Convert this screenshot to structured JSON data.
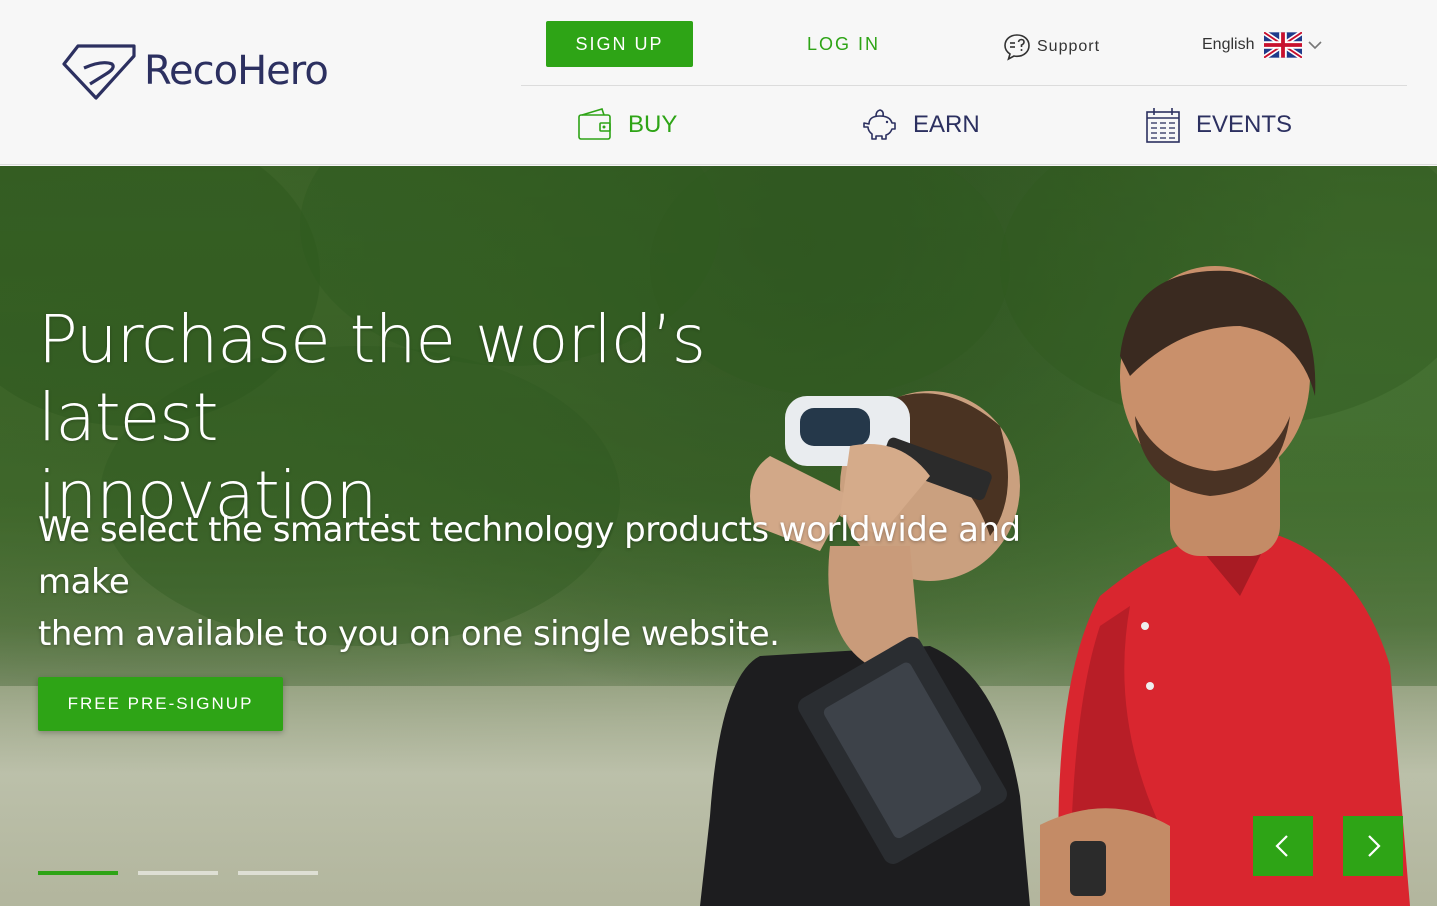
{
  "brand": {
    "name": "RecoHero"
  },
  "header": {
    "signup_label": "SIGN UP",
    "login_label": "LOG IN",
    "support_label": "Support",
    "language_label": "English"
  },
  "nav": {
    "buy": "BUY",
    "earn": "EARN",
    "events": "EVENTS"
  },
  "hero": {
    "headline_line1": "Purchase the world’s latest",
    "headline_line2": "innovation.",
    "subline_line1": "We select the smartest technology products worldwide and make",
    "subline_line2": "them available to you on one single website.",
    "cta_label": "FREE PRE-SIGNUP",
    "slides": {
      "count": 3,
      "active": 1
    }
  },
  "colors": {
    "accent": "#2ea416",
    "navy": "#2c3060"
  },
  "icons": [
    "logo-mark",
    "support-icon",
    "uk-flag-icon",
    "chevron-down-icon",
    "wallet-icon",
    "piggy-bank-icon",
    "calendar-icon",
    "chevron-left-icon",
    "chevron-right-icon"
  ]
}
